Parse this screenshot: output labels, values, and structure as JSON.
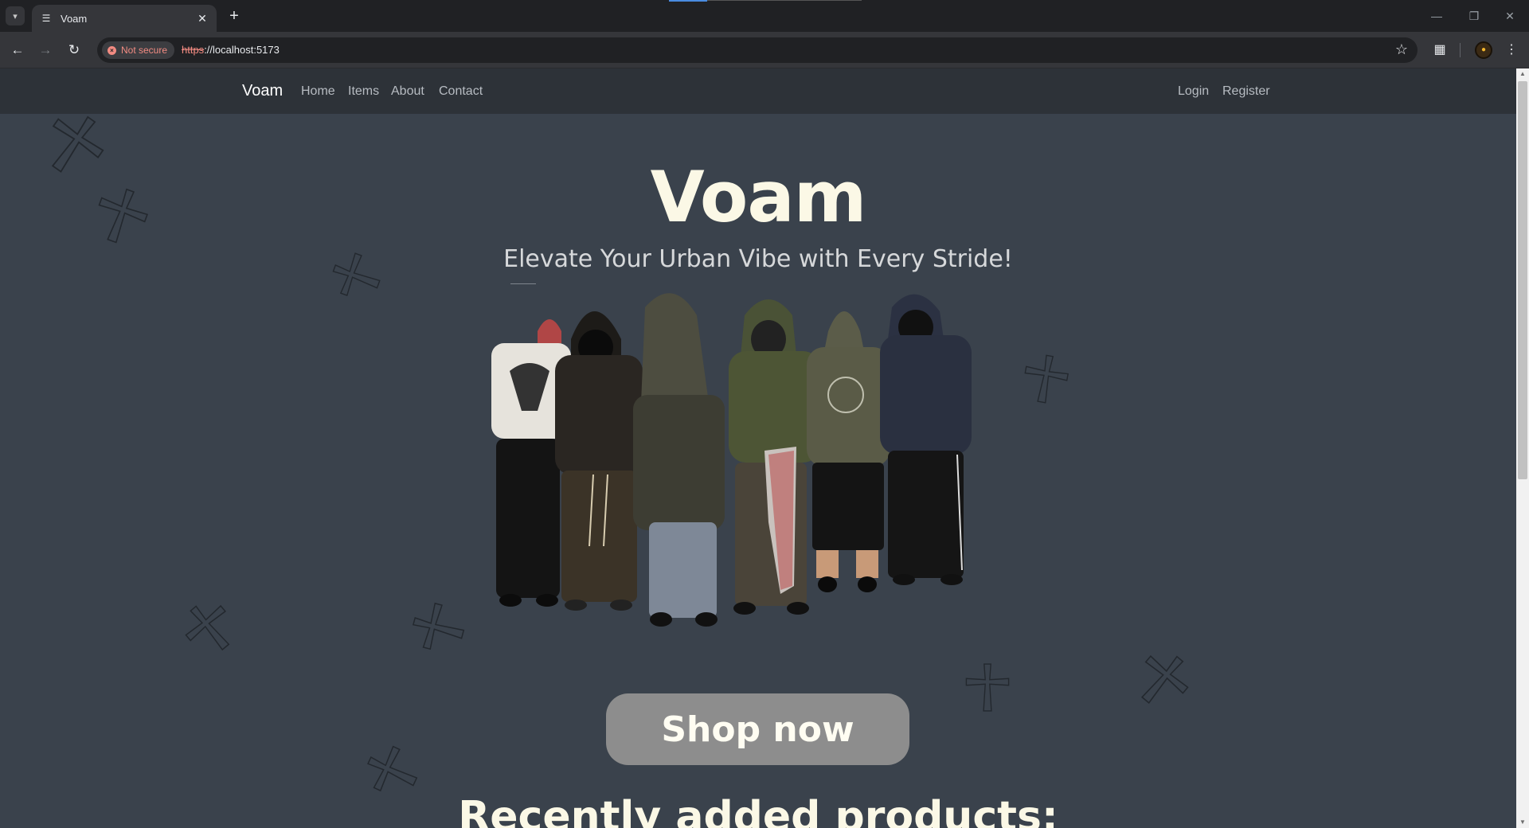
{
  "browser": {
    "tab_title": "Voam",
    "security_label": "Not secure",
    "url_scheme": "https",
    "url_rest": "://localhost:5173"
  },
  "site": {
    "brand": "Voam",
    "nav_links": [
      "Home",
      "Items",
      "About",
      "Contact"
    ],
    "auth_links": [
      "Login",
      "Register"
    ]
  },
  "hero": {
    "title": "Voam",
    "subtitle": "Elevate Your Urban Vibe with Every Stride!",
    "cta": "Shop now"
  },
  "section": {
    "recent_title": "Recently added products:"
  },
  "colors": {
    "page_bg": "#3a424c",
    "nav_bg": "#2d3238",
    "title_color": "#fbf8e6",
    "cta_bg": "#8d8d8d"
  }
}
